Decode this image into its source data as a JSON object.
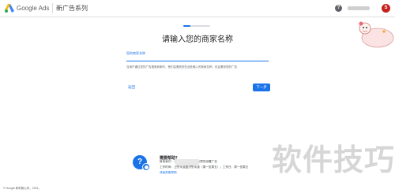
{
  "header": {
    "brand": "Google Ads",
    "campaign_title": "新广告系列",
    "help_icon": "?",
    "avatar_letter": "S"
  },
  "progress": {
    "fraction": 0.25
  },
  "main": {
    "title": "请输入您的商家名称",
    "field_label": "您的商家名称",
    "field_value": "",
    "field_hint": "当用户通过您的广告搜索商家时，他们会看到您在此处输入的商家名称，也会看到您的广告",
    "skip_label": "返回",
    "next_label": "下一步"
  },
  "support": {
    "chat_icon": "?",
    "title": "需要帮助？",
    "line1": "致电我们：                              我们的免费专家可以帮您设置广告",
    "line2": "工作时间：上午 9 点至下午 6 点（周一至周五）；工作日：周一至周五",
    "link": "或者获取帮助"
  },
  "watermark": "软件技巧",
  "footer": "© Google 和附属公司，2021。",
  "colors": {
    "accent": "#1a73e8",
    "avatar": "#c5221f"
  }
}
